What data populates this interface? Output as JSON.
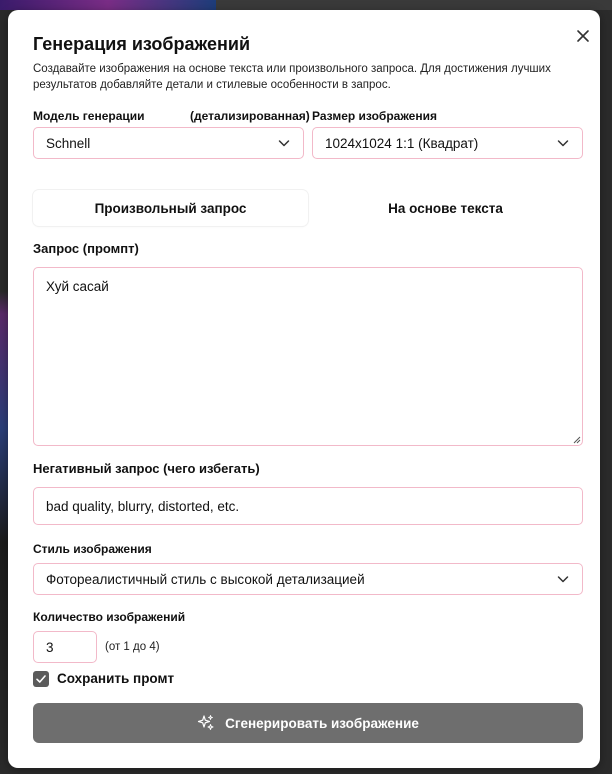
{
  "dialog": {
    "title": "Генерация изображений",
    "description": "Создавайте изображения на основе текста или произвольного запроса. Для достижения лучших результатов добавляйте детали и стилевые особенности в запрос.",
    "close_icon": "close-icon"
  },
  "model": {
    "label": "Модель генерации",
    "note": "(детализированная)",
    "value": "Schnell"
  },
  "size": {
    "label": "Размер изображения",
    "value": "1024x1024 1:1 (Квадрат)"
  },
  "tabs": [
    {
      "label": "Произвольный запрос",
      "active": true
    },
    {
      "label": "На основе текста",
      "active": false
    }
  ],
  "prompt": {
    "label": "Запрос (промпт)",
    "value": "Хуй сасай"
  },
  "negative": {
    "label": "Негативный запрос (чего избегать)",
    "value": "bad quality, blurry, distorted, etc."
  },
  "style": {
    "label": "Стиль изображения",
    "value": "Фотореалистичный стиль с высокой детализацией"
  },
  "count": {
    "label": "Количество изображений",
    "value": "3",
    "hint": "(от 1 до 4)"
  },
  "save_prompt": {
    "label": "Сохранить промт",
    "checked": true
  },
  "generate_button": {
    "label": "Сгенерировать изображение",
    "icon": "sparkles-icon"
  },
  "colors": {
    "field_border": "#f2b9c9",
    "button_bg": "#6e6e6e",
    "checkbox_bg": "#5b5b5b"
  }
}
